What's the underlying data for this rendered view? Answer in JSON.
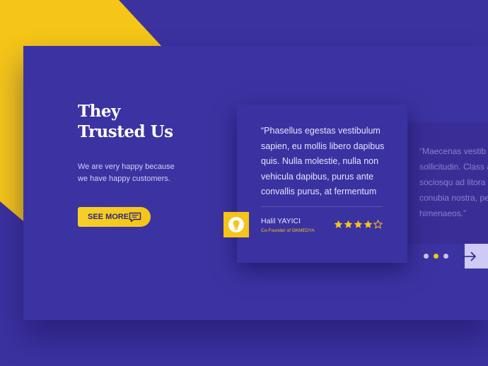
{
  "hero": {
    "title_line1": "They",
    "title_line2": "Trusted Us",
    "subtitle_line1": "We are very happy because",
    "subtitle_line2": "we have happy customers.",
    "cta_label": "SEE MORE"
  },
  "testimonials": [
    {
      "quote_lines": [
        "“Phasellus egestas vestibulum",
        "sapien, eu mollis libero dapibus",
        "quis. Nulla molestie, nulla non",
        "vehicula dapibus, purus ante",
        "convallis purus, at fermentum"
      ],
      "author": "Halil YAYICI",
      "role": "Co-Founder of GKMEDYA",
      "rating": 4,
      "rating_max": 5
    },
    {
      "quote_lines": [
        "“Maecenas vestib",
        "sollicitudin. Class a",
        "sociosqu ad litora",
        "conubia nostra, pe",
        "himenaeos.”"
      ]
    }
  ],
  "pagination": {
    "total": 3,
    "active_index": 1
  },
  "icons": {
    "cta": "chat-bubble-icon",
    "avatar": "lightbulb-icon",
    "next": "arrow-right-icon",
    "star": "star-icon"
  },
  "colors": {
    "background": "#3b32a0",
    "accent": "#f5c518",
    "text": "#ffffff"
  }
}
